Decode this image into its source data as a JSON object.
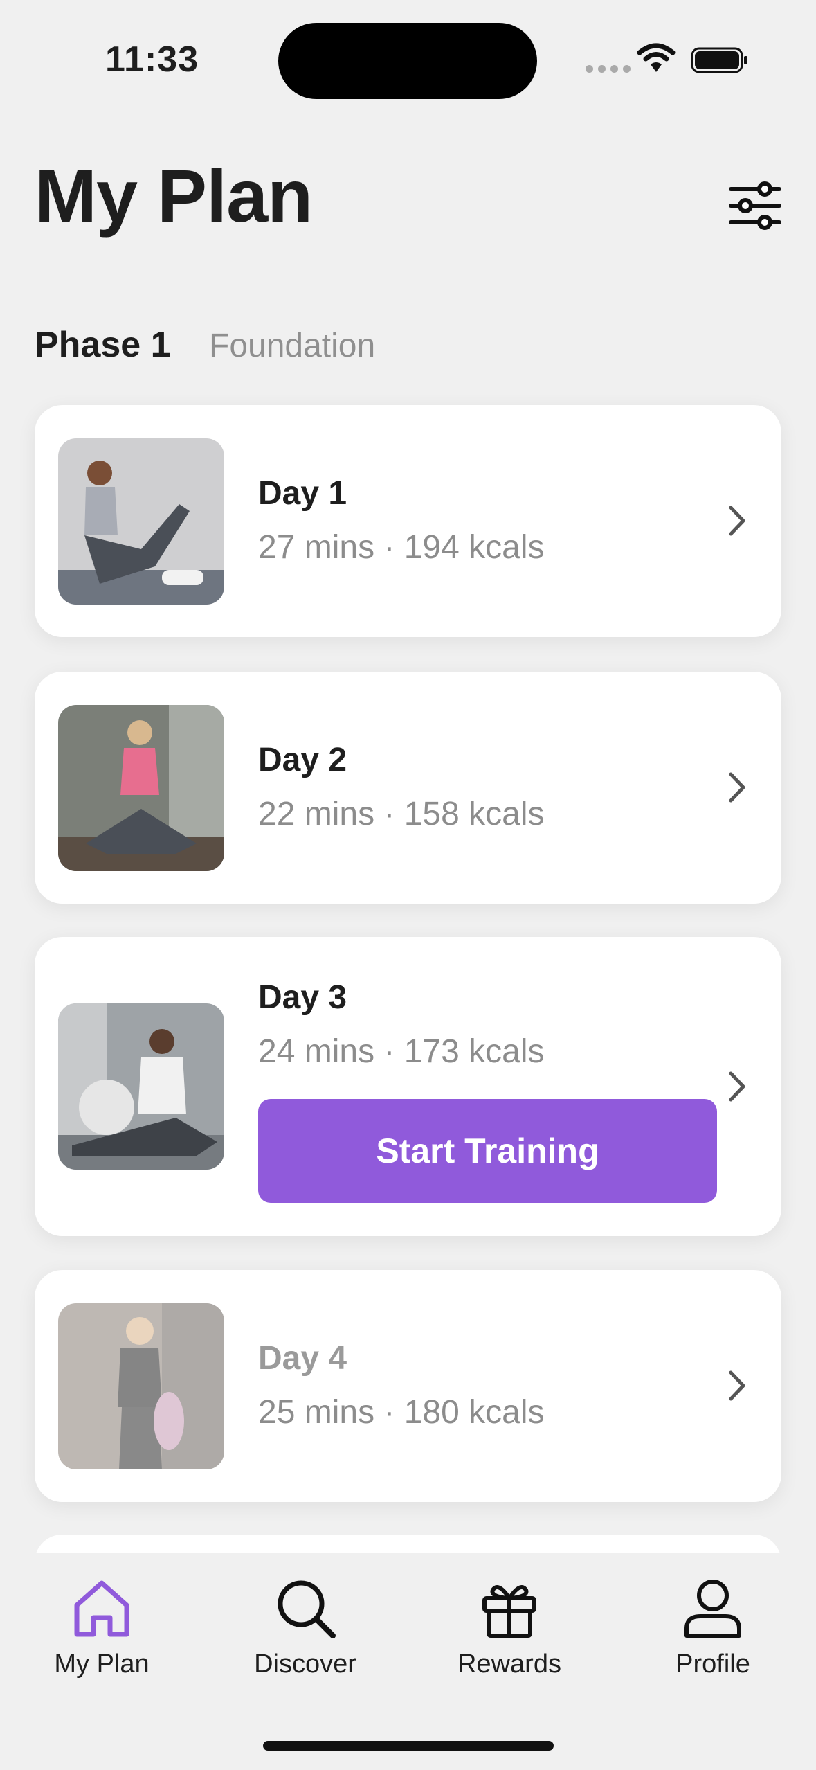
{
  "status_bar": {
    "time": "11:33"
  },
  "header": {
    "title": "My Plan"
  },
  "phase": {
    "label": "Phase 1",
    "name": "Foundation"
  },
  "days": [
    {
      "title": "Day 1",
      "meta": "27 mins · 194 kcals"
    },
    {
      "title": "Day 2",
      "meta": "22 mins · 158 kcals"
    },
    {
      "title": "Day 3",
      "meta": "24 mins · 173 kcals",
      "action": "Start Training"
    },
    {
      "title": "Day 4",
      "meta": "25 mins · 180 kcals"
    }
  ],
  "tabs": [
    {
      "label": "My Plan",
      "icon": "home-icon",
      "active": true
    },
    {
      "label": "Discover",
      "icon": "search-icon"
    },
    {
      "label": "Rewards",
      "icon": "gift-icon"
    },
    {
      "label": "Profile",
      "icon": "person-icon"
    }
  ],
  "colors": {
    "accent": "#905adb",
    "background": "#f0f0f0",
    "card": "#ffffff",
    "muted_text": "#8c8c8c"
  }
}
